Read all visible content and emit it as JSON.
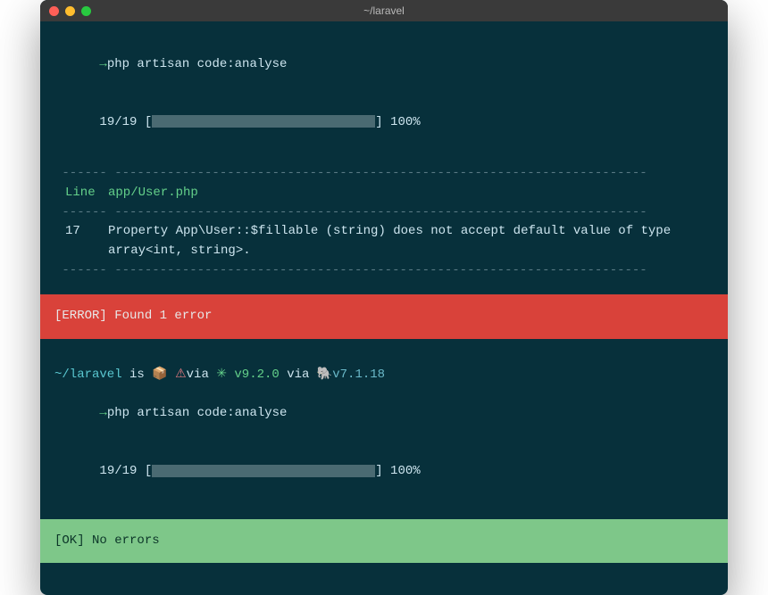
{
  "window": {
    "title": "~/laravel"
  },
  "first": {
    "prompt_arrow": "→",
    "command": "php artisan code:analyse",
    "progress_prefix": "19/19 [",
    "progress_suffix": "] 100%",
    "separator_short": " ------",
    "separator_long": " -----------------------------------------------------------------------",
    "header_line": "Line",
    "header_file": "app/User.php",
    "issue_line": "17",
    "issue_msg": "Property App\\User::$fillable (string) does not accept default value of type array<int, string>.",
    "error_banner": "[ERROR] Found 1 error"
  },
  "second": {
    "status_path": "~/laravel",
    "status_is": " is ",
    "status_pkg": "📦 ",
    "status_tri": "⚠",
    "status_via1": "via ",
    "status_dot": "✳",
    "status_version1": " v9.2.0",
    "status_via2": " via ",
    "status_ele": "🐘",
    "status_version2": "v7.1.18",
    "prompt_arrow": "→",
    "command": "php artisan code:analyse",
    "progress_prefix": "19/19 [",
    "progress_suffix": "] 100%",
    "ok_banner": "[OK] No errors"
  }
}
